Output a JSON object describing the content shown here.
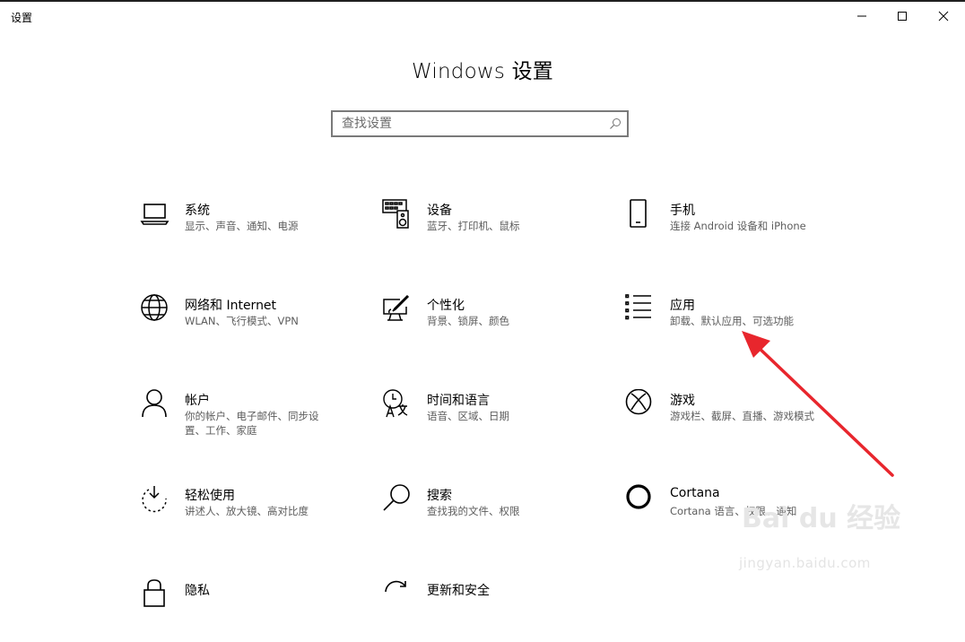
{
  "window": {
    "title": "设置",
    "controls": [
      "minimize-icon",
      "maximize-icon",
      "close-icon"
    ]
  },
  "page": {
    "title": "Windows 设置"
  },
  "search": {
    "placeholder": "查找设置",
    "value": ""
  },
  "tiles": [
    {
      "icon": "laptop-icon",
      "title": "系统",
      "subtitle": "显示、声音、通知、电源"
    },
    {
      "icon": "keyboard-speaker-icon",
      "title": "设备",
      "subtitle": "蓝牙、打印机、鼠标"
    },
    {
      "icon": "phone-icon",
      "title": "手机",
      "subtitle": "连接 Android 设备和 iPhone"
    },
    {
      "icon": "globe-icon",
      "title": "网络和 Internet",
      "subtitle": "WLAN、飞行模式、VPN"
    },
    {
      "icon": "paint-display-icon",
      "title": "个性化",
      "subtitle": "背景、锁屏、颜色"
    },
    {
      "icon": "apps-list-icon",
      "title": "应用",
      "subtitle": "卸载、默认应用、可选功能"
    },
    {
      "icon": "person-icon",
      "title": "帐户",
      "subtitle": "你的帐户、电子邮件、同步设置、工作、家庭"
    },
    {
      "icon": "time-language-icon",
      "title": "时间和语言",
      "subtitle": "语音、区域、日期"
    },
    {
      "icon": "xbox-icon",
      "title": "游戏",
      "subtitle": "游戏栏、截屏、直播、游戏模式"
    },
    {
      "icon": "ease-of-access-icon",
      "title": "轻松使用",
      "subtitle": "讲述人、放大镜、高对比度"
    },
    {
      "icon": "search-icon",
      "title": "搜索",
      "subtitle": "查找我的文件、权限"
    },
    {
      "icon": "cortana-ring-icon",
      "title": "Cortana",
      "subtitle": "Cortana 语言、权限、通知"
    },
    {
      "icon": "lock-icon",
      "title": "隐私",
      "subtitle": ""
    },
    {
      "icon": "update-sync-icon",
      "title": "更新和安全",
      "subtitle": ""
    }
  ],
  "annotation": {
    "color": "#e8262d",
    "points_to": "应用"
  },
  "watermark": {
    "logo": "Bai du 经验",
    "url": "jingyan.baidu.com"
  }
}
